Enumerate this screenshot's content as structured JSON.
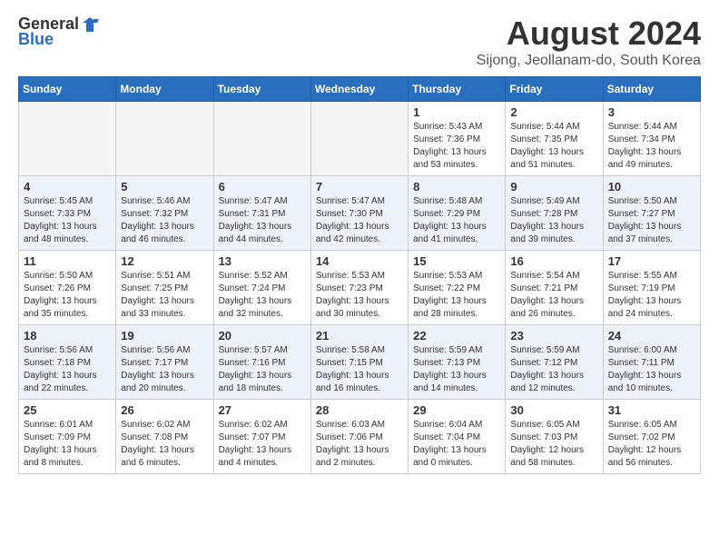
{
  "header": {
    "logo_general": "General",
    "logo_blue": "Blue",
    "title": "August 2024",
    "subtitle": "Sijong, Jeollanam-do, South Korea"
  },
  "days_of_week": [
    "Sunday",
    "Monday",
    "Tuesday",
    "Wednesday",
    "Thursday",
    "Friday",
    "Saturday"
  ],
  "weeks": [
    {
      "days": [
        {
          "num": "",
          "empty": true
        },
        {
          "num": "",
          "empty": true
        },
        {
          "num": "",
          "empty": true
        },
        {
          "num": "",
          "empty": true
        },
        {
          "num": "1",
          "sunrise": "5:43 AM",
          "sunset": "7:36 PM",
          "daylight": "Daylight: 13 hours and 53 minutes."
        },
        {
          "num": "2",
          "sunrise": "5:44 AM",
          "sunset": "7:35 PM",
          "daylight": "Daylight: 13 hours and 51 minutes."
        },
        {
          "num": "3",
          "sunrise": "5:44 AM",
          "sunset": "7:34 PM",
          "daylight": "Daylight: 13 hours and 49 minutes."
        }
      ]
    },
    {
      "days": [
        {
          "num": "4",
          "sunrise": "5:45 AM",
          "sunset": "7:33 PM",
          "daylight": "Daylight: 13 hours and 48 minutes."
        },
        {
          "num": "5",
          "sunrise": "5:46 AM",
          "sunset": "7:32 PM",
          "daylight": "Daylight: 13 hours and 46 minutes."
        },
        {
          "num": "6",
          "sunrise": "5:47 AM",
          "sunset": "7:31 PM",
          "daylight": "Daylight: 13 hours and 44 minutes."
        },
        {
          "num": "7",
          "sunrise": "5:47 AM",
          "sunset": "7:30 PM",
          "daylight": "Daylight: 13 hours and 42 minutes."
        },
        {
          "num": "8",
          "sunrise": "5:48 AM",
          "sunset": "7:29 PM",
          "daylight": "Daylight: 13 hours and 41 minutes."
        },
        {
          "num": "9",
          "sunrise": "5:49 AM",
          "sunset": "7:28 PM",
          "daylight": "Daylight: 13 hours and 39 minutes."
        },
        {
          "num": "10",
          "sunrise": "5:50 AM",
          "sunset": "7:27 PM",
          "daylight": "Daylight: 13 hours and 37 minutes."
        }
      ]
    },
    {
      "days": [
        {
          "num": "11",
          "sunrise": "5:50 AM",
          "sunset": "7:26 PM",
          "daylight": "Daylight: 13 hours and 35 minutes."
        },
        {
          "num": "12",
          "sunrise": "5:51 AM",
          "sunset": "7:25 PM",
          "daylight": "Daylight: 13 hours and 33 minutes."
        },
        {
          "num": "13",
          "sunrise": "5:52 AM",
          "sunset": "7:24 PM",
          "daylight": "Daylight: 13 hours and 32 minutes."
        },
        {
          "num": "14",
          "sunrise": "5:53 AM",
          "sunset": "7:23 PM",
          "daylight": "Daylight: 13 hours and 30 minutes."
        },
        {
          "num": "15",
          "sunrise": "5:53 AM",
          "sunset": "7:22 PM",
          "daylight": "Daylight: 13 hours and 28 minutes."
        },
        {
          "num": "16",
          "sunrise": "5:54 AM",
          "sunset": "7:21 PM",
          "daylight": "Daylight: 13 hours and 26 minutes."
        },
        {
          "num": "17",
          "sunrise": "5:55 AM",
          "sunset": "7:19 PM",
          "daylight": "Daylight: 13 hours and 24 minutes."
        }
      ]
    },
    {
      "days": [
        {
          "num": "18",
          "sunrise": "5:56 AM",
          "sunset": "7:18 PM",
          "daylight": "Daylight: 13 hours and 22 minutes."
        },
        {
          "num": "19",
          "sunrise": "5:56 AM",
          "sunset": "7:17 PM",
          "daylight": "Daylight: 13 hours and 20 minutes."
        },
        {
          "num": "20",
          "sunrise": "5:57 AM",
          "sunset": "7:16 PM",
          "daylight": "Daylight: 13 hours and 18 minutes."
        },
        {
          "num": "21",
          "sunrise": "5:58 AM",
          "sunset": "7:15 PM",
          "daylight": "Daylight: 13 hours and 16 minutes."
        },
        {
          "num": "22",
          "sunrise": "5:59 AM",
          "sunset": "7:13 PM",
          "daylight": "Daylight: 13 hours and 14 minutes."
        },
        {
          "num": "23",
          "sunrise": "5:59 AM",
          "sunset": "7:12 PM",
          "daylight": "Daylight: 13 hours and 12 minutes."
        },
        {
          "num": "24",
          "sunrise": "6:00 AM",
          "sunset": "7:11 PM",
          "daylight": "Daylight: 13 hours and 10 minutes."
        }
      ]
    },
    {
      "days": [
        {
          "num": "25",
          "sunrise": "6:01 AM",
          "sunset": "7:09 PM",
          "daylight": "Daylight: 13 hours and 8 minutes."
        },
        {
          "num": "26",
          "sunrise": "6:02 AM",
          "sunset": "7:08 PM",
          "daylight": "Daylight: 13 hours and 6 minutes."
        },
        {
          "num": "27",
          "sunrise": "6:02 AM",
          "sunset": "7:07 PM",
          "daylight": "Daylight: 13 hours and 4 minutes."
        },
        {
          "num": "28",
          "sunrise": "6:03 AM",
          "sunset": "7:06 PM",
          "daylight": "Daylight: 13 hours and 2 minutes."
        },
        {
          "num": "29",
          "sunrise": "6:04 AM",
          "sunset": "7:04 PM",
          "daylight": "Daylight: 13 hours and 0 minutes."
        },
        {
          "num": "30",
          "sunrise": "6:05 AM",
          "sunset": "7:03 PM",
          "daylight": "Daylight: 12 hours and 58 minutes."
        },
        {
          "num": "31",
          "sunrise": "6:05 AM",
          "sunset": "7:02 PM",
          "daylight": "Daylight: 12 hours and 56 minutes."
        }
      ]
    }
  ]
}
